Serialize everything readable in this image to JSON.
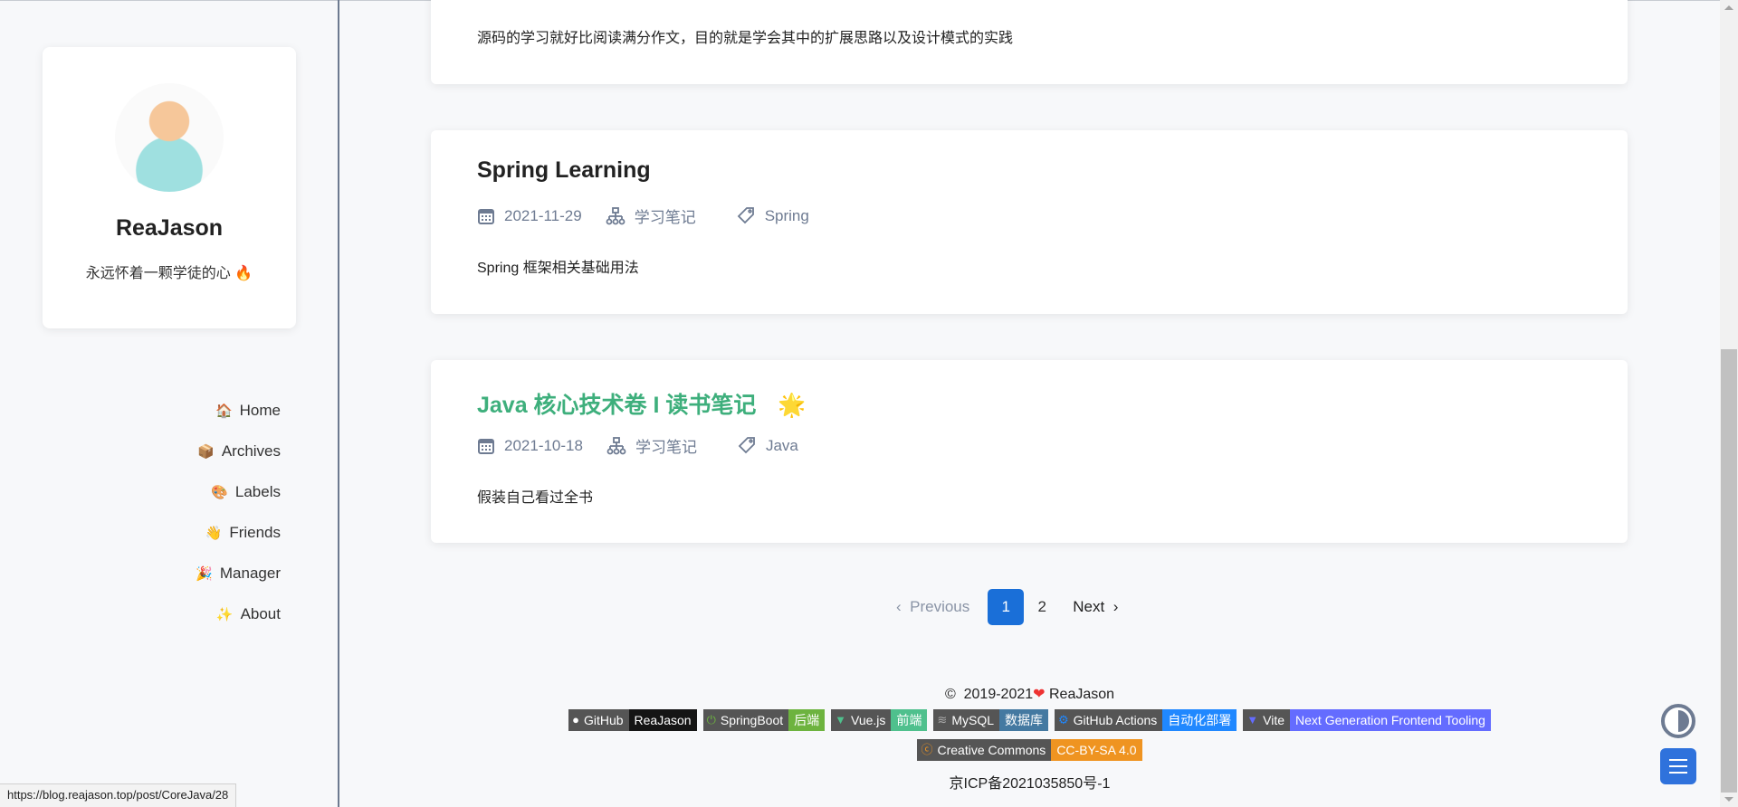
{
  "profile": {
    "name": "ReaJason",
    "motto": "永远怀着一颗学徒的心",
    "motto_emoji": "🔥"
  },
  "nav": [
    {
      "emoji": "🏠",
      "label": "Home"
    },
    {
      "emoji": "📦",
      "label": "Archives"
    },
    {
      "emoji": "🎨",
      "label": "Labels"
    },
    {
      "emoji": "👋",
      "label": "Friends"
    },
    {
      "emoji": "🎉",
      "label": "Manager"
    },
    {
      "emoji": "✨",
      "label": "About"
    }
  ],
  "posts": [
    {
      "desc": "源码的学习就好比阅读满分作文，目的就是学会其中的扩展思路以及设计模式的实践"
    },
    {
      "title": "Spring Learning",
      "date": "2021-11-29",
      "category": "学习笔记",
      "tag": "Spring",
      "desc": "Spring 框架相关基础用法"
    },
    {
      "title": "Java 核心技术卷 I 读书笔记",
      "sticky_icon": "🌟",
      "date": "2021-10-18",
      "category": "学习笔记",
      "tag": "Java",
      "desc": "假装自己看过全书"
    }
  ],
  "pagination": {
    "previous": "Previous",
    "pages": [
      "1",
      "2"
    ],
    "current": "1",
    "next": "Next"
  },
  "footer": {
    "copyright_symbol": "©",
    "years": "2019-2021",
    "heart": "❤",
    "author": "ReaJason",
    "badges": [
      {
        "icon": "github-icon",
        "label": "GitHub",
        "value": "ReaJason",
        "color": "#151515"
      },
      {
        "icon": "springboot-icon",
        "label": "SpringBoot",
        "value": "后端",
        "color": "#6db33f"
      },
      {
        "icon": "vue-icon",
        "label": "Vue.js",
        "value": "前端",
        "color": "#4fc08d"
      },
      {
        "icon": "mysql-icon",
        "label": "MySQL",
        "value": "数据库",
        "color": "#4479a1"
      },
      {
        "icon": "github-actions-icon",
        "label": "GitHub Actions",
        "value": "自动化部署",
        "color": "#2088ff"
      },
      {
        "icon": "vite-icon",
        "label": "Vite",
        "value": "Next Generation Frontend Tooling",
        "color": "#646cff"
      }
    ],
    "license": {
      "icon": "creative-commons-icon",
      "label": "Creative Commons",
      "value": "CC-BY-SA 4.0",
      "color": "#ef9421"
    },
    "icp": "京ICP备2021035850号-1"
  },
  "status_url": "https://blog.reajason.top/post/CoreJava/28",
  "colors": {
    "accent": "#3eaf7c",
    "primary": "#1a6fd8",
    "meta": "#6e7b92"
  }
}
